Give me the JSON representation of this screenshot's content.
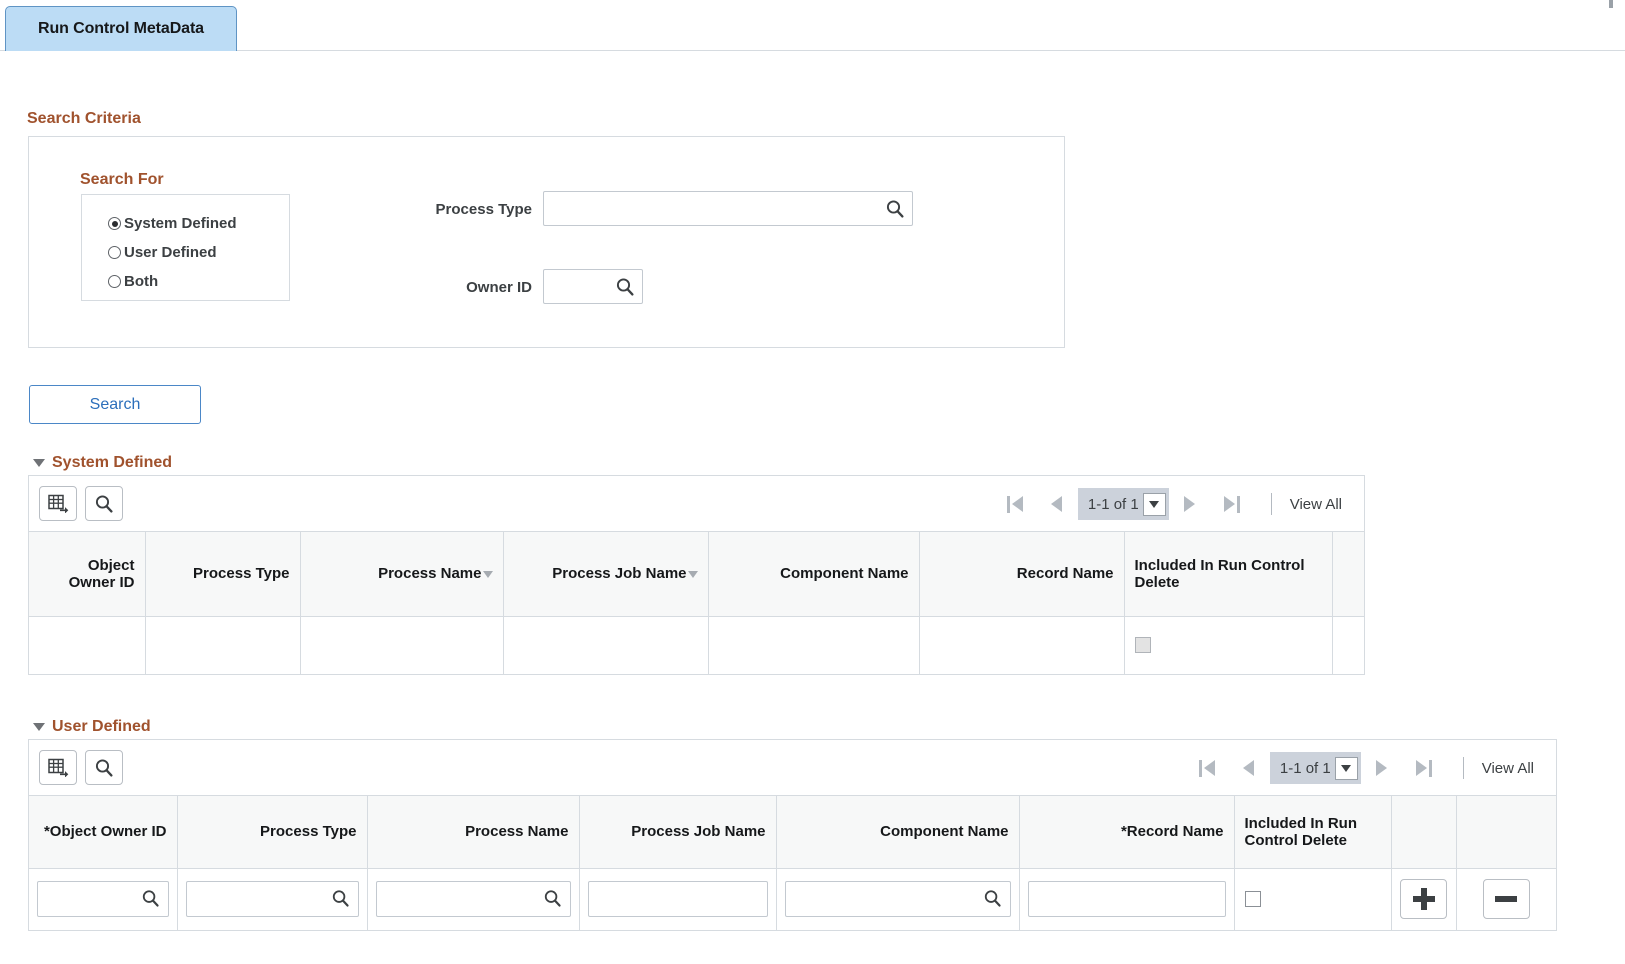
{
  "tab": {
    "label": "Run Control MetaData"
  },
  "search_criteria": {
    "title": "Search Criteria",
    "search_for": {
      "title": "Search For",
      "options": [
        {
          "label": "System Defined",
          "selected": true
        },
        {
          "label": "User Defined",
          "selected": false
        },
        {
          "label": "Both",
          "selected": false
        }
      ]
    },
    "fields": [
      {
        "label": "Process Type",
        "value": "",
        "icon": "magnifier-icon"
      },
      {
        "label": "Owner ID",
        "value": "",
        "icon": "magnifier-icon"
      }
    ],
    "search_button": "Search"
  },
  "system_defined": {
    "title": "System Defined",
    "toolbar": {
      "personalize_icon": "grid-personalize-icon",
      "find_icon": "magnifier-icon"
    },
    "pager": {
      "first_icon": "first-page-icon",
      "prev_icon": "previous-page-icon",
      "count": "1-1 of 1",
      "dropdown_icon": "chevron-down-icon",
      "next_icon": "next-page-icon",
      "last_icon": "last-page-icon",
      "view_all": "View All"
    },
    "columns": [
      {
        "label": "Object Owner ID",
        "align": "right",
        "sort": false
      },
      {
        "label": "Process Type",
        "align": "right",
        "sort": false
      },
      {
        "label": "Process Name",
        "align": "right",
        "sort": true
      },
      {
        "label": "Process Job Name",
        "align": "right",
        "sort": true
      },
      {
        "label": "Component Name",
        "align": "right",
        "sort": false
      },
      {
        "label": "Record Name",
        "align": "right",
        "sort": false
      },
      {
        "label": "Included In Run Control Delete",
        "align": "left",
        "sort": false
      },
      {
        "label": "",
        "align": "left",
        "sort": false
      }
    ],
    "rows": [
      {
        "object_owner_id": "",
        "process_type": "",
        "process_name": "",
        "process_job_name": "",
        "component_name": "",
        "record_name": "",
        "included_checked": false,
        "included_disabled": true
      }
    ]
  },
  "user_defined": {
    "title": "User Defined",
    "toolbar": {
      "personalize_icon": "grid-personalize-icon",
      "find_icon": "magnifier-icon"
    },
    "pager": {
      "first_icon": "first-page-icon",
      "prev_icon": "previous-page-icon",
      "count": "1-1 of 1",
      "dropdown_icon": "chevron-down-icon",
      "next_icon": "next-page-icon",
      "last_icon": "last-page-icon",
      "view_all": "View All"
    },
    "columns": [
      {
        "label": "*Object Owner ID",
        "align": "right"
      },
      {
        "label": "Process Type",
        "align": "right"
      },
      {
        "label": "Process Name",
        "align": "right"
      },
      {
        "label": "Process Job Name",
        "align": "right"
      },
      {
        "label": "Component Name",
        "align": "right"
      },
      {
        "label": "*Record Name",
        "align": "right"
      },
      {
        "label": "Included In Run Control Delete",
        "align": "left"
      },
      {
        "label": "",
        "align": "left"
      },
      {
        "label": "",
        "align": "left"
      }
    ],
    "rows": [
      {
        "object_owner_id": "",
        "object_owner_id_has_lookup": true,
        "process_type": "",
        "process_type_has_lookup": true,
        "process_name": "",
        "process_name_has_lookup": true,
        "process_job_name": "",
        "process_job_name_has_lookup": false,
        "component_name": "",
        "component_name_has_lookup": true,
        "record_name": "",
        "record_name_has_lookup": false,
        "included_checked": false,
        "add_label": "+",
        "delete_label": "-"
      }
    ]
  },
  "colors": {
    "section_title": "#a0522d",
    "tab_background": "#bcdcf5",
    "tab_border": "#5f94c4",
    "button_text": "#2c6fbb",
    "grid_border": "#d6dbe0",
    "header_background": "#f7f8f8",
    "pager_background": "#ccd2db"
  }
}
